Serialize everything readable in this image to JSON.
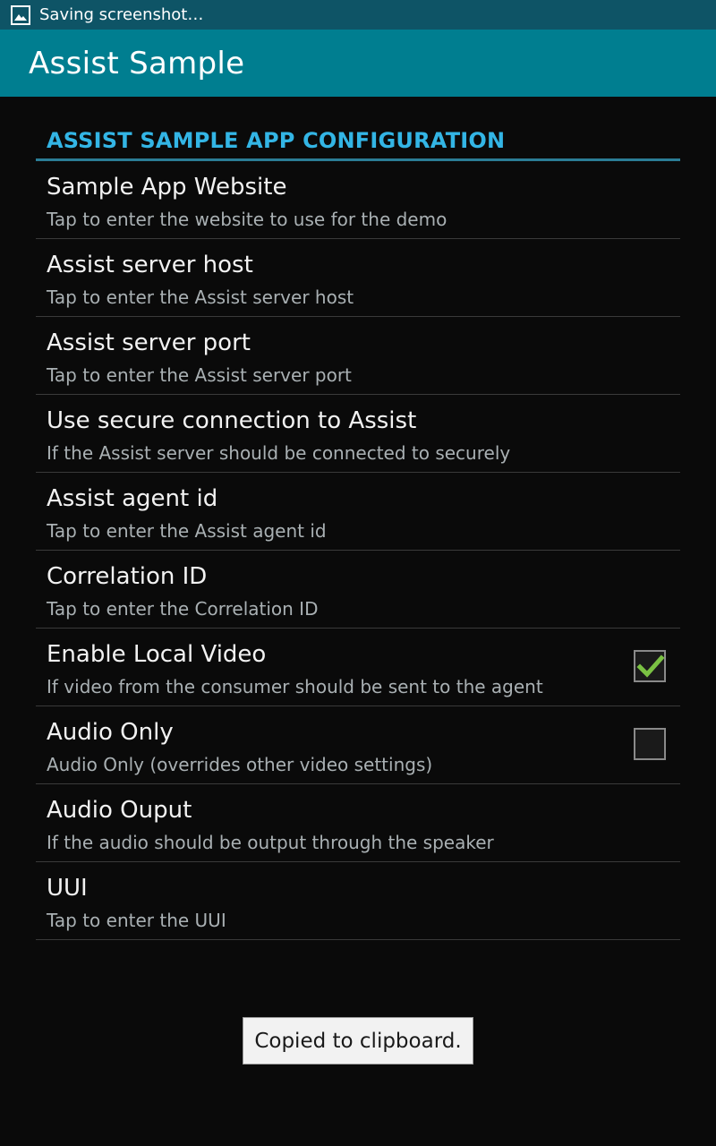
{
  "status_bar": {
    "icon": "image-icon",
    "text": "Saving screenshot…"
  },
  "action_bar": {
    "title": "Assist Sample"
  },
  "category": {
    "title": "ASSIST SAMPLE APP CONFIGURATION"
  },
  "preferences": [
    {
      "title": "Sample App Website",
      "summary": "Tap to enter the website to use for the demo"
    },
    {
      "title": "Assist server host",
      "summary": "Tap to enter the Assist server host"
    },
    {
      "title": "Assist server port",
      "summary": "Tap to enter the Assist server port"
    },
    {
      "title": "Use secure connection to Assist",
      "summary": "If the Assist server should be connected to securely"
    },
    {
      "title": "Assist agent id",
      "summary": "Tap to enter the Assist agent id"
    },
    {
      "title": "Correlation ID",
      "summary": "Tap to enter the Correlation ID"
    },
    {
      "title": "Enable Local Video",
      "summary": "If video from the consumer should be sent to the agent",
      "checked": true
    },
    {
      "title": "Audio Only",
      "summary": "Audio Only (overrides other video settings)",
      "checked": false
    },
    {
      "title": "Audio Ouput",
      "summary": "If the audio should be output through the speaker"
    },
    {
      "title": "UUI",
      "summary": "Tap to enter the UUI"
    }
  ],
  "toast": {
    "text": "Copied to clipboard."
  },
  "colors": {
    "status_bar": "#0e5466",
    "action_bar": "#007e90",
    "accent": "#33b5e5",
    "check": "#7ac143"
  }
}
